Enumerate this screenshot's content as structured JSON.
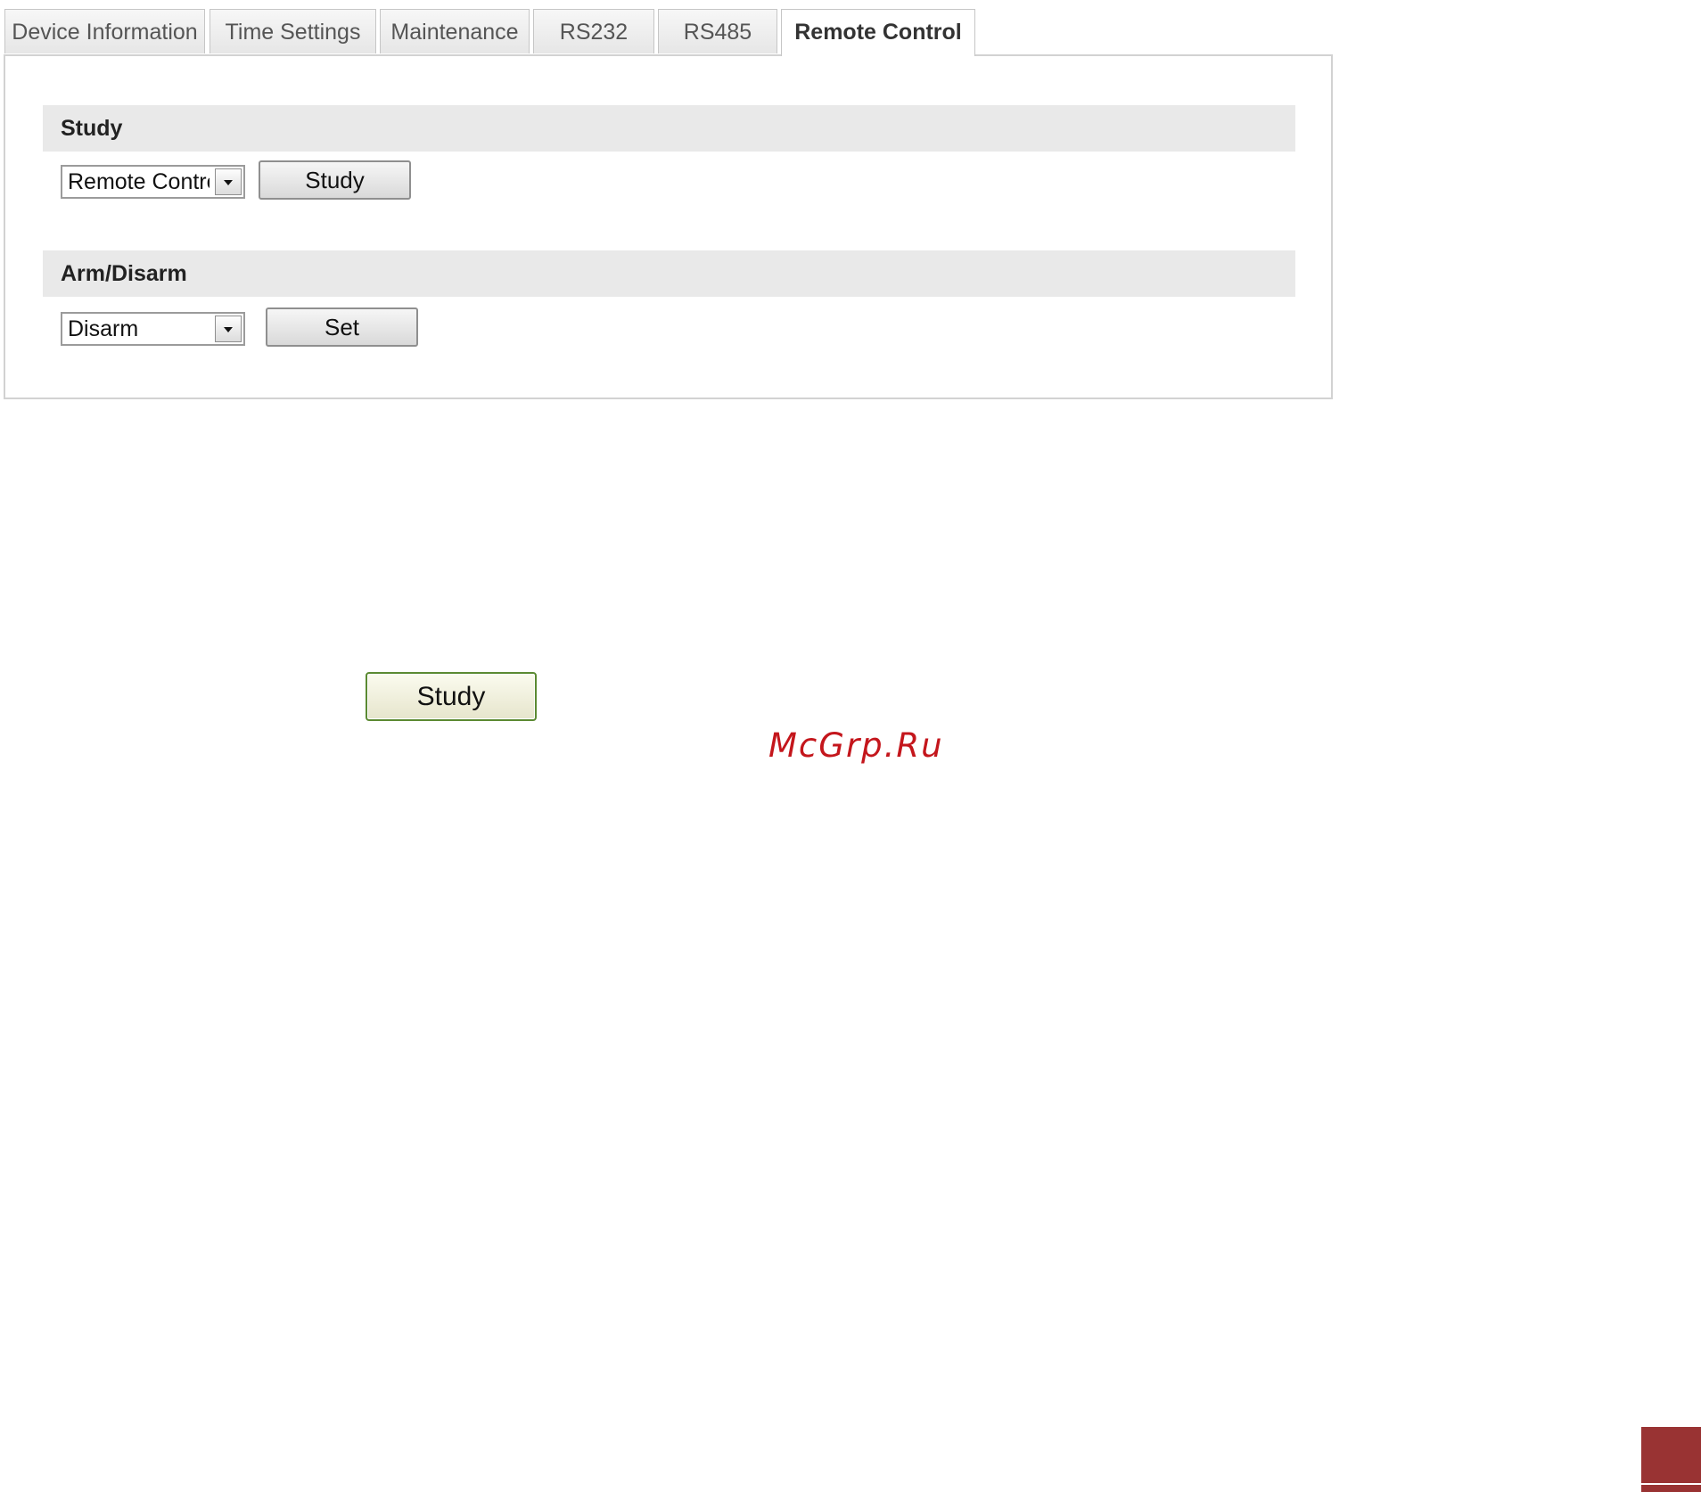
{
  "tabs": [
    {
      "label": "Device Information",
      "active": false
    },
    {
      "label": "Time Settings",
      "active": false
    },
    {
      "label": "Maintenance",
      "active": false
    },
    {
      "label": "RS232",
      "active": false
    },
    {
      "label": "RS485",
      "active": false
    },
    {
      "label": "Remote Control",
      "active": true
    }
  ],
  "study_section": {
    "title": "Study",
    "select_value": "Remote Control",
    "button_label": "Study"
  },
  "arm_section": {
    "title": "Arm/Disarm",
    "select_value": "Disarm",
    "button_label": "Set"
  },
  "illustration": {
    "button_label": "Study"
  },
  "watermark": "McGrp.Ru",
  "colors": {
    "watermark": "#c4161c",
    "section_header_bg": "#e9e9e9",
    "corner_block": "#993333",
    "illustration_button_border": "#5b8a32"
  },
  "icons": {
    "select_arrow": "chevron-down-icon"
  }
}
